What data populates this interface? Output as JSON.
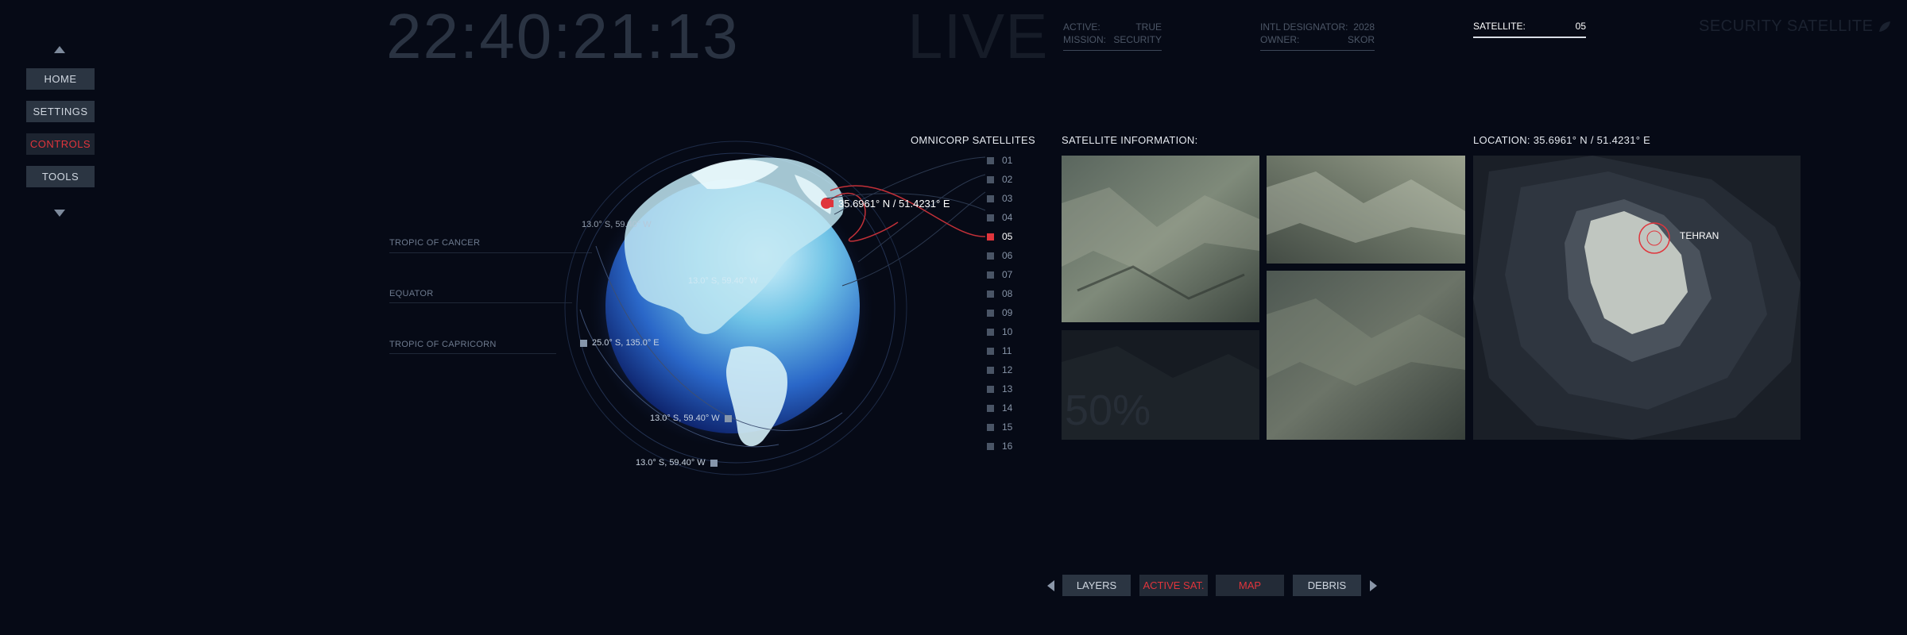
{
  "nav": {
    "items": [
      {
        "label": "HOME",
        "active": false
      },
      {
        "label": "SETTINGS",
        "active": false
      },
      {
        "label": "CONTROLS",
        "active": true
      },
      {
        "label": "TOOLS",
        "active": false
      }
    ]
  },
  "header": {
    "clock": "22:40:21:13",
    "live": "LIVE",
    "status": [
      {
        "key": "ACTIVE:",
        "value": "TRUE"
      },
      {
        "key": "MISSION:",
        "value": "SECURITY"
      }
    ],
    "designation": [
      {
        "key": "INTL DESIGNATOR:",
        "value": "2028"
      },
      {
        "key": "OWNER:",
        "value": "SKOR"
      }
    ],
    "satellite_label": "SATELLITE:",
    "satellite_value": "05",
    "brand": "SECURITY SATELLITE"
  },
  "globe": {
    "tropic_cancer": "TROPIC OF CANCER",
    "equator": "EQUATOR",
    "tropic_capricorn": "TROPIC OF CAPRICORN",
    "target_coord": "35.6961° N / 51.4231° E",
    "coords": [
      "13.0° S, 59.40° W",
      "13.0° S, 59.40° W",
      "25.0° S, 135.0° E",
      "13.0° S, 59.40° W",
      "13.0° S, 59.40° W"
    ]
  },
  "satellites": {
    "title": "OMNICORP SATELLITES",
    "selected": "05",
    "items": [
      "01",
      "02",
      "03",
      "04",
      "05",
      "06",
      "07",
      "08",
      "09",
      "10",
      "11",
      "12",
      "13",
      "14",
      "15",
      "16"
    ]
  },
  "info": {
    "title": "SATELLITE INFORMATION:",
    "overlay_percent": "50%"
  },
  "location": {
    "title": "LOCATION: 35.6961° N / 51.4231° E",
    "city": "TEHRAN"
  },
  "toolbar": {
    "buttons": [
      {
        "label": "LAYERS",
        "highlight": false
      },
      {
        "label": "ACTIVE SAT.",
        "highlight": true
      },
      {
        "label": "MAP",
        "highlight": true
      },
      {
        "label": "DEBRIS",
        "highlight": false
      }
    ]
  },
  "colors": {
    "background": "#060a16",
    "accent_red": "#e0353c",
    "button_bg": "#2b3542"
  }
}
